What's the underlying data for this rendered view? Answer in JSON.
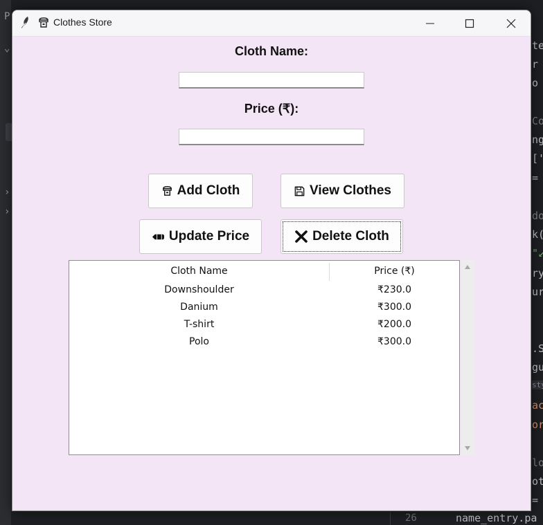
{
  "window": {
    "title": "Clothes Store",
    "title_icon": "dress-icon"
  },
  "form": {
    "name_label": "Cloth Name:",
    "name_value": "",
    "price_label": "Price (₹):",
    "price_value": ""
  },
  "buttons": {
    "add": {
      "label": "Add Cloth",
      "icon": "dress-icon"
    },
    "view": {
      "label": "View Clothes",
      "icon": "floppy-disk-icon"
    },
    "update": {
      "label": "Update Price",
      "icon": "pencil-icon"
    },
    "delete": {
      "label": "Delete Cloth",
      "icon": "cross-mark-icon"
    }
  },
  "table": {
    "columns": [
      "Cloth Name",
      "Price (₹)"
    ],
    "rows": [
      [
        "Downshoulder",
        "₹230.0"
      ],
      [
        "Danium",
        "₹300.0"
      ],
      [
        "T-shirt",
        "₹200.0"
      ],
      [
        "Polo",
        "₹300.0"
      ]
    ]
  },
  "background_editor": {
    "left_chars": [
      "P",
      "⌄",
      "›",
      "›"
    ],
    "code_fragments": [
      "te",
      "r",
      "o",
      "Co",
      "ng",
      "['",
      "=",
      "do",
      "k(",
      "\"↙",
      "ry",
      "ur",
      ".S",
      "gu",
      "sty",
      "ac",
      "or",
      "lo",
      "ot",
      "="
    ],
    "line_number": "26",
    "bottom_line": "name_entry.pa"
  },
  "colors": {
    "window_bg": "#f3e5f5",
    "editor_bg": "#1e1f22",
    "button_bg": "#fdfdfd"
  }
}
